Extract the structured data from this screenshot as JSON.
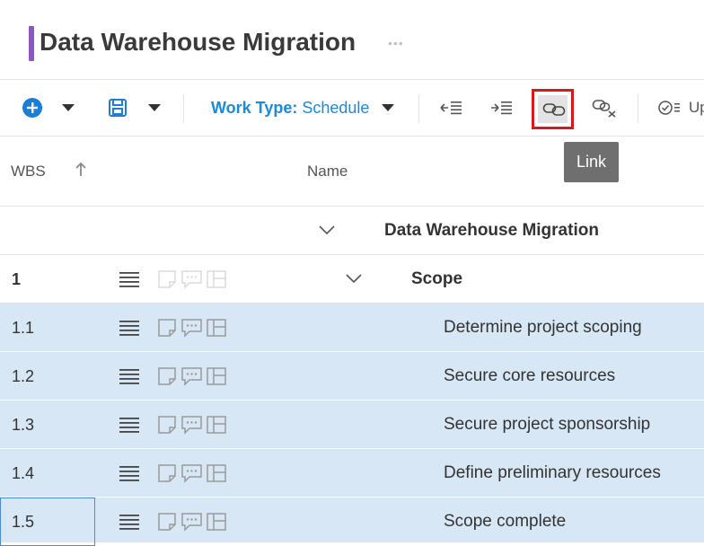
{
  "project": {
    "title": "Data Warehouse Migration",
    "more": "•••"
  },
  "toolbar": {
    "add_icon": "plus-circle-icon",
    "save_icon": "save-icon",
    "work_type_label": "Work Type:",
    "work_type_value": "Schedule",
    "outdent_icon": "outdent-icon",
    "indent_icon": "indent-icon",
    "link_icon": "link-icon",
    "unlink_icon": "unlink-icon",
    "update_icon": "check-list-icon",
    "update_text": "Up",
    "accent_color": "#1b8ad8",
    "highlight_color": "#d7191b"
  },
  "tooltip": {
    "text": "Link"
  },
  "grid": {
    "columns": {
      "wbs": "WBS",
      "name": "Name"
    },
    "rows": [
      {
        "wbs": "",
        "name": "Data Warehouse Migration",
        "level": 0,
        "summary": true,
        "selected": false
      },
      {
        "wbs": "1",
        "name": "Scope",
        "level": 1,
        "summary": true,
        "selected": false
      },
      {
        "wbs": "1.1",
        "name": "Determine project scoping",
        "level": 2,
        "summary": false,
        "selected": true
      },
      {
        "wbs": "1.2",
        "name": "Secure core resources",
        "level": 2,
        "summary": false,
        "selected": true
      },
      {
        "wbs": "1.3",
        "name": "Secure project sponsorship",
        "level": 2,
        "summary": false,
        "selected": true
      },
      {
        "wbs": "1.4",
        "name": "Define preliminary resources",
        "level": 2,
        "summary": false,
        "selected": true
      },
      {
        "wbs": "1.5",
        "name": "Scope complete",
        "level": 2,
        "summary": false,
        "selected": true
      }
    ]
  }
}
